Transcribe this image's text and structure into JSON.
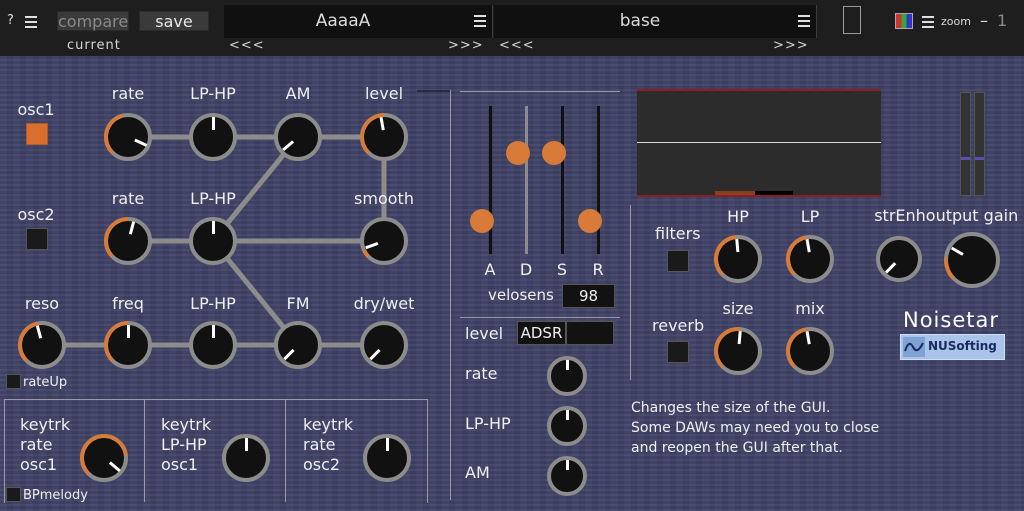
{
  "topbar": {
    "help": "?",
    "compare": "compare",
    "save": "save",
    "current": "current",
    "preset_a": "AaaaA",
    "preset_b": "base",
    "prev": "<<<",
    "next": ">>>",
    "zoom_label": "zoom",
    "zoom_minus": "–",
    "zoom_value": "1"
  },
  "osc": {
    "osc1_label": "osc1",
    "osc2_label": "osc2",
    "row1": {
      "rate": "rate",
      "lphp": "LP-HP",
      "am": "AM",
      "level": "level"
    },
    "row2": {
      "rate": "rate",
      "lphp": "LP-HP",
      "smooth": "smooth"
    },
    "row3": {
      "reso": "reso",
      "freq": "freq",
      "lphp": "LP-HP",
      "fm": "FM",
      "drywet": "dry/wet"
    },
    "rateup": "rateUp",
    "bpmelody": "BPmelody"
  },
  "keytrk": [
    {
      "line1": "keytrk",
      "line2": "rate",
      "line3": "osc1"
    },
    {
      "line1": "keytrk",
      "line2": "LP-HP",
      "line3": "osc1"
    },
    {
      "line1": "keytrk",
      "line2": "rate",
      "line3": "osc2"
    }
  ],
  "envelope": {
    "a": "A",
    "d": "D",
    "s": "S",
    "r": "R",
    "a_val": 0.22,
    "d_val": 0.68,
    "s_val": 0.68,
    "r_val": 0.22,
    "velosens_label": "velosens",
    "velosens_value": "98",
    "level_label": "level",
    "level_mode": "ADSR",
    "rate": "rate",
    "lphp": "LP-HP",
    "am": "AM"
  },
  "fx": {
    "filters": "filters",
    "hp": "HP",
    "lp": "LP",
    "reverb": "reverb",
    "size": "size",
    "mix": "mix",
    "strenh": "strEnh",
    "output_gain": "output gain"
  },
  "brand": {
    "name": "Noisetar",
    "company": "NUSofting"
  },
  "info_text": [
    "Changes the size of the GUI.",
    "Some DAWs may need you to close",
    "and reopen the GUI after that."
  ],
  "colors": {
    "accent": "#d87a38",
    "panel": "#3f4266",
    "knob": "#111111",
    "ring": "#8c8c8c"
  }
}
